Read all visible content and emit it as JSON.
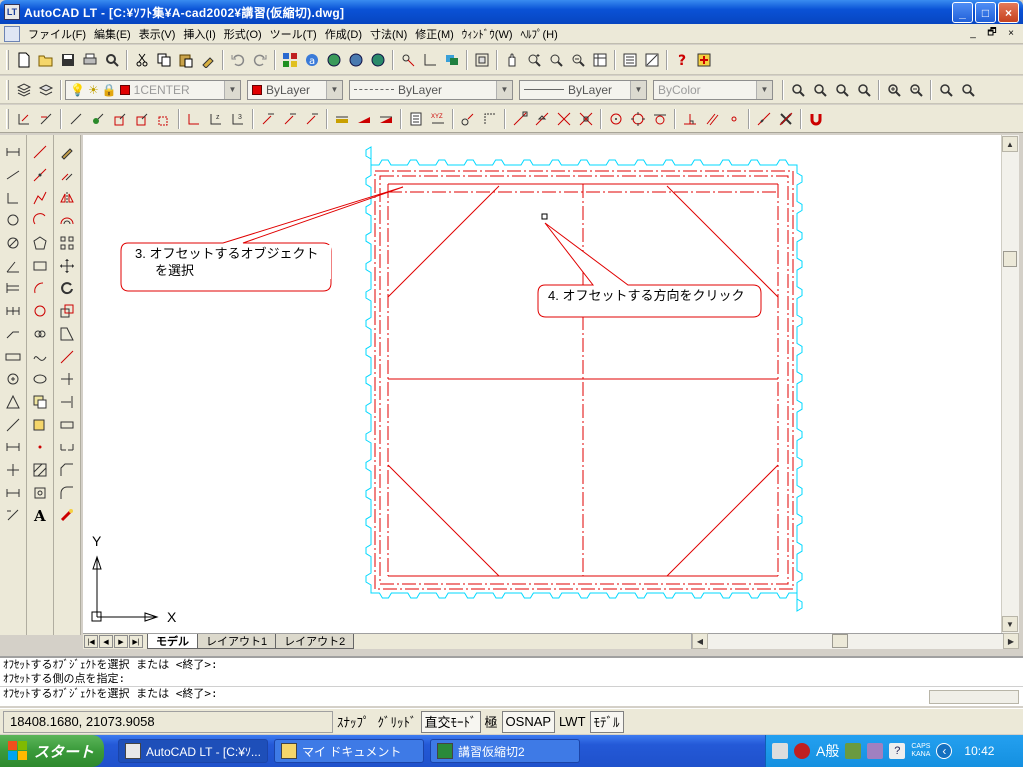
{
  "window": {
    "app_icon": "LT",
    "title": "AutoCAD LT - [C:¥ｿﾌﾄ集¥A-cad2002¥講習(仮縮切).dwg]",
    "controls": [
      "minimize",
      "maximize",
      "close"
    ]
  },
  "menubar": {
    "items": [
      "ファイル(F)",
      "編集(E)",
      "表示(V)",
      "挿入(I)",
      "形式(O)",
      "ツール(T)",
      "作成(D)",
      "寸法(N)",
      "修正(M)",
      "ｳｨﾝﾄﾞｳ(W)",
      "ﾍﾙﾌﾟ(H)"
    ],
    "mdi_controls": [
      "_",
      "🗗",
      "×"
    ]
  },
  "toolbar_properties": {
    "layer": "1CENTER",
    "color": "ByLayer",
    "linetype": "ByLayer",
    "lineweight": "ByLayer",
    "plotstyle": "ByColor"
  },
  "drawing": {
    "callout1_line1": "3. オフセットするオブジェクト",
    "callout1_line2": "を選択",
    "callout2": "4. オフセットする方向をクリック",
    "ucs_y": "Y",
    "ucs_x": "X",
    "colors": {
      "red": "#e00000",
      "cyan": "#00d8ff"
    }
  },
  "tabs": {
    "items": [
      "モデル",
      "レイアウト1",
      "レイアウト2"
    ],
    "active": "モデル"
  },
  "command": {
    "lines": [
      "ｵﾌｾｯﾄするｵﾌﾞｼﾞｪｸﾄを選択 または <終了>:",
      "ｵﾌｾｯﾄする側の点を指定:",
      "ｵﾌｾｯﾄするｵﾌﾞｼﾞｪｸﾄを選択 または <終了>:"
    ]
  },
  "status": {
    "coords": "18408.1680, 21073.9058",
    "snap": "ｽﾅｯﾌﾟ",
    "grid": "ｸﾞﾘｯﾄﾞ",
    "ortho": "直交ﾓｰﾄﾞ",
    "polar": "極",
    "osnap": "OSNAP",
    "lwt": "LWT",
    "model": "ﾓﾃﾞﾙ"
  },
  "taskbar": {
    "start": "スタート",
    "tasks": [
      "AutoCAD LT - [C:¥ｿ...",
      "マイ ドキュメント",
      "講習仮縮切2"
    ],
    "ime": "A般",
    "caps": "CAPS",
    "kana": "KANA",
    "clock": "10:42"
  }
}
